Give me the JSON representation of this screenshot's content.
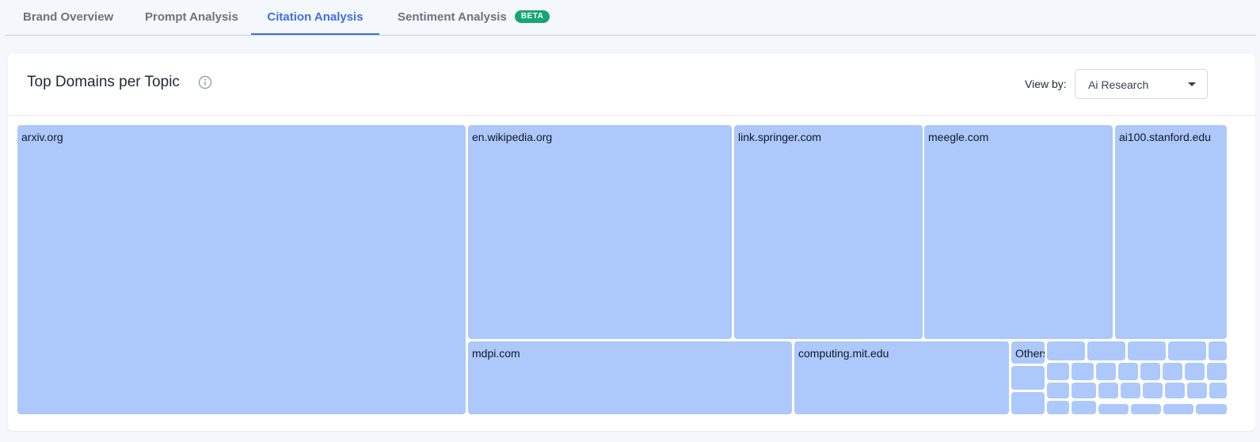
{
  "tabs": [
    {
      "label": "Brand Overview",
      "active": false
    },
    {
      "label": "Prompt Analysis",
      "active": false
    },
    {
      "label": "Citation Analysis",
      "active": true
    },
    {
      "label": "Sentiment Analysis",
      "active": false,
      "badge": "BETA"
    }
  ],
  "card": {
    "title": "Top Domains per Topic",
    "info_icon": "info-icon",
    "view_by_label": "View by:",
    "view_by_value": "Ai Research"
  },
  "treemap": {
    "cell_color": "#adc8fa",
    "cells": [
      {
        "label": "arxiv.org"
      },
      {
        "label": "en.wikipedia.org"
      },
      {
        "label": "link.springer.com"
      },
      {
        "label": "meegle.com"
      },
      {
        "label": "ai100.stanford.edu"
      },
      {
        "label": "mdpi.com"
      },
      {
        "label": "computing.mit.edu"
      },
      {
        "label": "Others"
      }
    ]
  }
}
